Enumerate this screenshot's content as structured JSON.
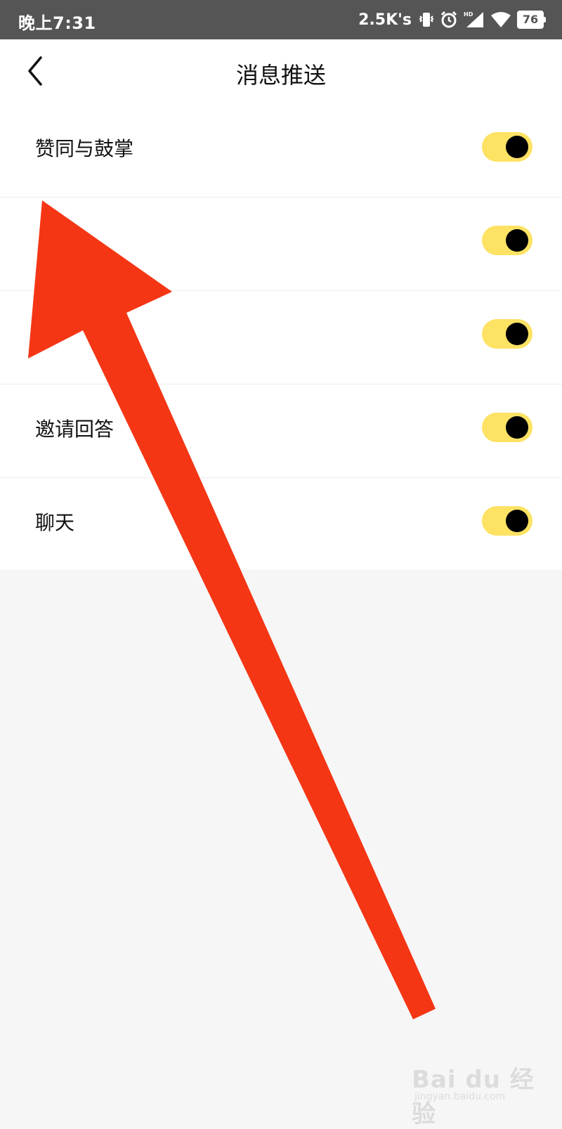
{
  "status_bar": {
    "time": "晚上7:31",
    "network_speed": "2.5K's",
    "battery_level": "76",
    "icons": [
      "vibrate-icon",
      "alarm-icon",
      "hd-signal-icon",
      "wifi-icon",
      "battery-icon"
    ]
  },
  "header": {
    "back_icon": "chevron-left-icon",
    "title": "消息推送"
  },
  "settings": [
    {
      "label": "赞同与鼓掌",
      "enabled": true
    },
    {
      "label": "",
      "enabled": true
    },
    {
      "label": "",
      "enabled": true
    },
    {
      "label": "邀请回答",
      "enabled": true
    },
    {
      "label": "聊天",
      "enabled": true
    }
  ],
  "colors": {
    "status_bar": "#555555",
    "toggle_track": "#fde264",
    "toggle_knob": "#000000",
    "annotation_arrow": "#f53615",
    "page_background": "#f6f6f6"
  },
  "watermark": {
    "brand": "Bai du 经验",
    "url": "jingyan.baidu.com"
  }
}
